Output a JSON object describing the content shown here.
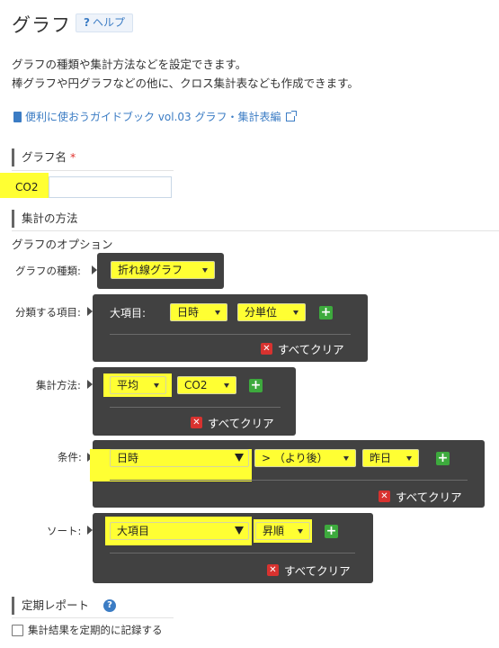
{
  "page": {
    "title": "グラフ",
    "help_label": "ヘルプ",
    "desc_line1": "グラフの種類や集計方法などを設定できます。",
    "desc_line2": "棒グラフや円グラフなどの他に、クロス集計表なども作成できます。",
    "guide_link": "便利に使おうガイドブック vol.03 グラフ・集計表編"
  },
  "graph_name": {
    "label": "グラフ名",
    "required_mark": "*",
    "value": "CO2"
  },
  "aggregation": {
    "section_label": "集計の方法",
    "options_title": "グラフのオプション",
    "chart_type": {
      "label": "グラフの種類:",
      "value": "折れ線グラフ"
    },
    "classify": {
      "label": "分類する項目:",
      "sub_label": "大項目:",
      "field": "日時",
      "unit": "分単位",
      "clear_label": "すべてクリア"
    },
    "method": {
      "label": "集計方法:",
      "func": "平均",
      "field": "CO2",
      "clear_label": "すべてクリア"
    },
    "condition": {
      "label": "条件:",
      "field": "日時",
      "operator": "> （より後）",
      "value": "昨日",
      "clear_label": "すべてクリア"
    },
    "sort": {
      "label": "ソート:",
      "field": "大項目",
      "order": "昇順",
      "clear_label": "すべてクリア"
    }
  },
  "periodic": {
    "section_label": "定期レポート",
    "checkbox_label": "集計結果を定期的に記録する",
    "checked": false
  },
  "colors": {
    "highlight": "#ffff33",
    "panel": "#414141",
    "link": "#3b7cc4",
    "add": "#3daa3d",
    "clear": "#d8322f"
  }
}
